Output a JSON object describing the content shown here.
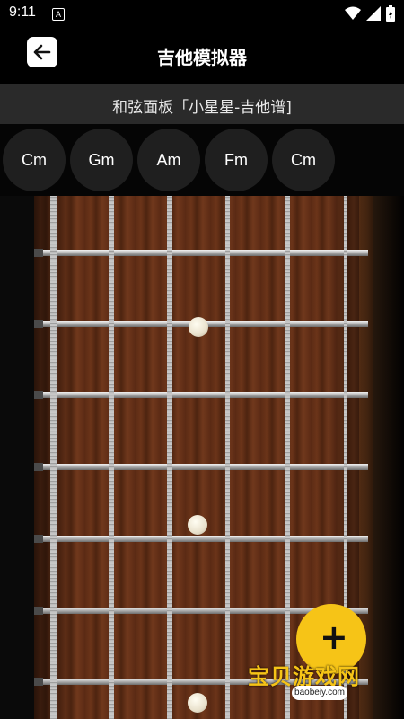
{
  "status_bar": {
    "time": "9:11",
    "notif_letter": "A"
  },
  "header": {
    "title": "吉他模拟器"
  },
  "panel": {
    "label": "和弦面板「小星星-吉他谱]"
  },
  "chords": [
    "Cm",
    "Gm",
    "Am",
    "Fm",
    "Cm"
  ],
  "watermark": {
    "text": "宝贝游戏网",
    "url": "baobeiy.com"
  },
  "colors": {
    "accent": "#f6c417",
    "wood": "#5b2a14",
    "bar": "#2a2a2a"
  },
  "icons": [
    "back-arrow-icon",
    "wifi-icon",
    "signal-icon",
    "battery-icon"
  ]
}
